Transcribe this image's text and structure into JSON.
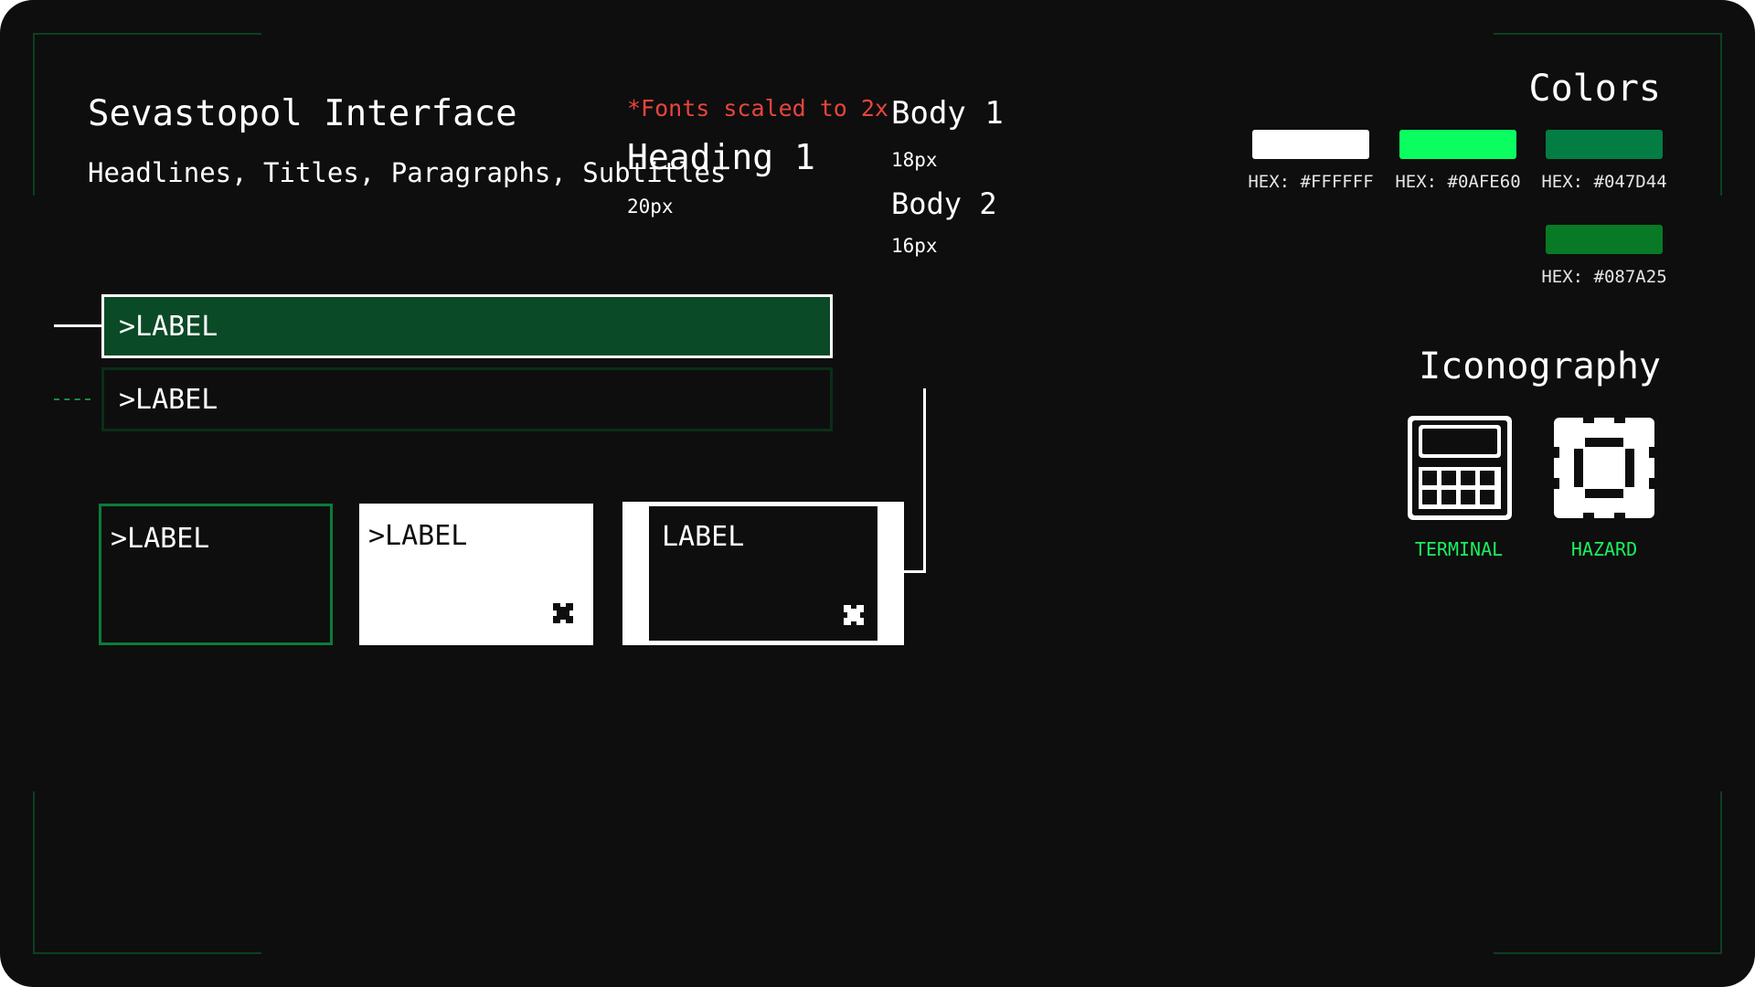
{
  "header": {
    "title": "Sevastopol Interface",
    "subtitle": "Headlines, Titles, Paragraphs, Subtitles"
  },
  "typography": {
    "note": "*Fonts scaled to 2x",
    "heading1": {
      "label": "Heading 1",
      "size": "20px"
    },
    "body1": {
      "label": "Body 1",
      "size": "18px"
    },
    "body2": {
      "label": "Body 2",
      "size": "16px"
    }
  },
  "colors": {
    "title": "Colors",
    "swatches": [
      {
        "hex": "#FFFFFF",
        "label": "HEX: #FFFFFF"
      },
      {
        "hex": "#0AFE60",
        "label": "HEX: #0AFE60"
      },
      {
        "hex": "#047D44",
        "label": "HEX: #047D44"
      },
      {
        "hex": "#087A25",
        "label": "HEX: #087A25"
      }
    ]
  },
  "components": {
    "bar_selected": ">LABEL",
    "bar_default": ">LABEL",
    "card_outline": ">LABEL",
    "card_filled": ">LABEL",
    "card_framed": "LABEL"
  },
  "iconography": {
    "title": "Iconography",
    "icons": [
      {
        "name": "terminal-icon",
        "label": "TERMINAL"
      },
      {
        "name": "hazard-icon",
        "label": "HAZARD"
      }
    ]
  },
  "accent": {
    "green": "#1AF060",
    "note_red": "#E8453C"
  }
}
